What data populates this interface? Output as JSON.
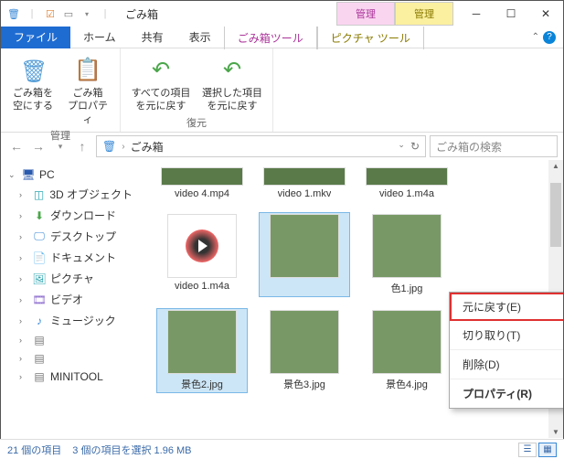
{
  "window": {
    "title": "ごみ箱",
    "divider": "|"
  },
  "contextual_tabs": [
    {
      "parent": "管理",
      "label": "ごみ箱ツール"
    },
    {
      "parent": "管理",
      "label": "ピクチャ ツール"
    }
  ],
  "tabs": {
    "file": "ファイル",
    "home": "ホーム",
    "share": "共有",
    "view": "表示"
  },
  "ribbon": {
    "manage": {
      "label": "管理",
      "empty": "ごみ箱を\n空にする",
      "props": "ごみ箱\nプロパティ"
    },
    "restore": {
      "label": "復元",
      "restore_all": "すべての項目\nを元に戻す",
      "restore_sel": "選択した項目\nを元に戻す"
    }
  },
  "address": {
    "location": "ごみ箱",
    "separator": "›"
  },
  "search": {
    "placeholder": "ごみ箱の検索"
  },
  "sidebar": {
    "root": "PC",
    "items": [
      {
        "icon": "cube",
        "label": "3D オブジェクト"
      },
      {
        "icon": "download",
        "label": "ダウンロード"
      },
      {
        "icon": "desktop",
        "label": "デスクトップ"
      },
      {
        "icon": "doc",
        "label": "ドキュメント"
      },
      {
        "icon": "picture",
        "label": "ピクチャ"
      },
      {
        "icon": "video",
        "label": "ビデオ"
      },
      {
        "icon": "music",
        "label": "ミュージック"
      },
      {
        "icon": "disk",
        "label": ""
      },
      {
        "icon": "disk",
        "label": ""
      },
      {
        "icon": "disk",
        "label": "MINITOOL"
      }
    ]
  },
  "files": [
    {
      "name": "video 4.mp4",
      "type": "video-strip"
    },
    {
      "name": "video 1.mkv",
      "type": "video-strip"
    },
    {
      "name": "video 1.m4a",
      "type": "video-strip"
    },
    {
      "name": "video 1.m4a",
      "type": "play-icon"
    },
    {
      "name": "",
      "type": "sunset",
      "selected": true
    },
    {
      "name": "色1.jpg",
      "type": "landscape"
    },
    {
      "name": "景色2.jpg",
      "type": "landscape",
      "selected": true
    },
    {
      "name": "景色3.jpg",
      "type": "landscape"
    },
    {
      "name": "景色4.jpg",
      "type": "landscape"
    }
  ],
  "context_menu": {
    "items": [
      {
        "label": "元に戻す(E)",
        "highlight": true
      },
      {
        "label": "切り取り(T)"
      },
      {
        "label": "削除(D)"
      },
      {
        "label": "プロパティ(R)"
      }
    ]
  },
  "status": {
    "count": "21 個の項目",
    "selected": "3 個の項目を選択 1.96 MB"
  }
}
